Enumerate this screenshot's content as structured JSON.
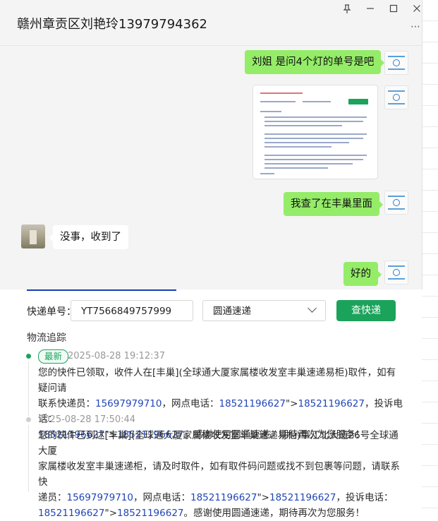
{
  "chat": {
    "title": "赣州章贡区刘艳玲13979794362",
    "window_controls": [
      "pin-icon",
      "minimize-icon",
      "maximize-icon",
      "close-icon"
    ],
    "more_label": "⋯",
    "messages": [
      {
        "side": "out",
        "type": "text",
        "text": "刘姐 是问4个灯的单号是吧"
      },
      {
        "side": "out",
        "type": "image",
        "alt": "courier-lookup-screenshot"
      },
      {
        "side": "out",
        "type": "text",
        "text": "我查了在丰巢里面"
      },
      {
        "side": "in",
        "type": "text",
        "text": "没事，收到了"
      },
      {
        "side": "out",
        "type": "text",
        "text": "好的"
      }
    ]
  },
  "lookup": {
    "label_tracking": "快递单号：",
    "tracking_number": "YT7566849757999",
    "courier": "圆通速递",
    "search_button": "查快递",
    "section_title": "物流追踪",
    "events": [
      {
        "badge": "最新",
        "time": "2025-08-28 19:12:37",
        "lines": [
          [
            {
              "t": "您的快件已领取，收件人在[丰巢](全球通大厦家属楼收发室丰巢速递易柜)取件，如有疑问请"
            }
          ],
          [
            {
              "t": "联系快递员："
            },
            {
              "t": "15697979710",
              "link": true
            },
            {
              "t": "，网点电话："
            },
            {
              "t": "18521196627",
              "link": true
            },
            {
              "t": "\">"
            },
            {
              "t": "18521196627",
              "link": true
            },
            {
              "t": "，投诉电话："
            }
          ],
          [
            {
              "t": "18521196627",
              "link": true
            },
            {
              "t": "\">"
            },
            {
              "t": "18521196627",
              "link": true
            },
            {
              "t": "。感谢使用圆通速递，期待再次为您服务！"
            }
          ]
        ]
      },
      {
        "badge": "",
        "time": "2025-08-28 17:50:44",
        "lines": [
          [
            {
              "t": "您的快件已到达[丰巢](全球通大厦家属楼收发室丰巢速递易柜)章江北大道26号全球通大厦"
            }
          ],
          [
            {
              "t": "家属楼收发室丰巢速递柜，请及时取件，如有取件码问题或找不到包裹等问题，请联系快"
            }
          ],
          [
            {
              "t": "递员："
            },
            {
              "t": "15697979710",
              "link": true
            },
            {
              "t": "，网点电话："
            },
            {
              "t": "18521196627",
              "link": true
            },
            {
              "t": "\">"
            },
            {
              "t": "18521196627",
              "link": true
            },
            {
              "t": "，投诉电话："
            }
          ],
          [
            {
              "t": "18521196627",
              "link": true
            },
            {
              "t": "\">"
            },
            {
              "t": "18521196627",
              "link": true
            },
            {
              "t": "。感谢使用圆通速递，期待再次为您服务！"
            }
          ]
        ]
      }
    ]
  },
  "colors": {
    "bubble_out": "#95ec69",
    "bubble_in": "#ffffff",
    "accent_green": "#1ba35b",
    "link_blue": "#2145b8"
  }
}
